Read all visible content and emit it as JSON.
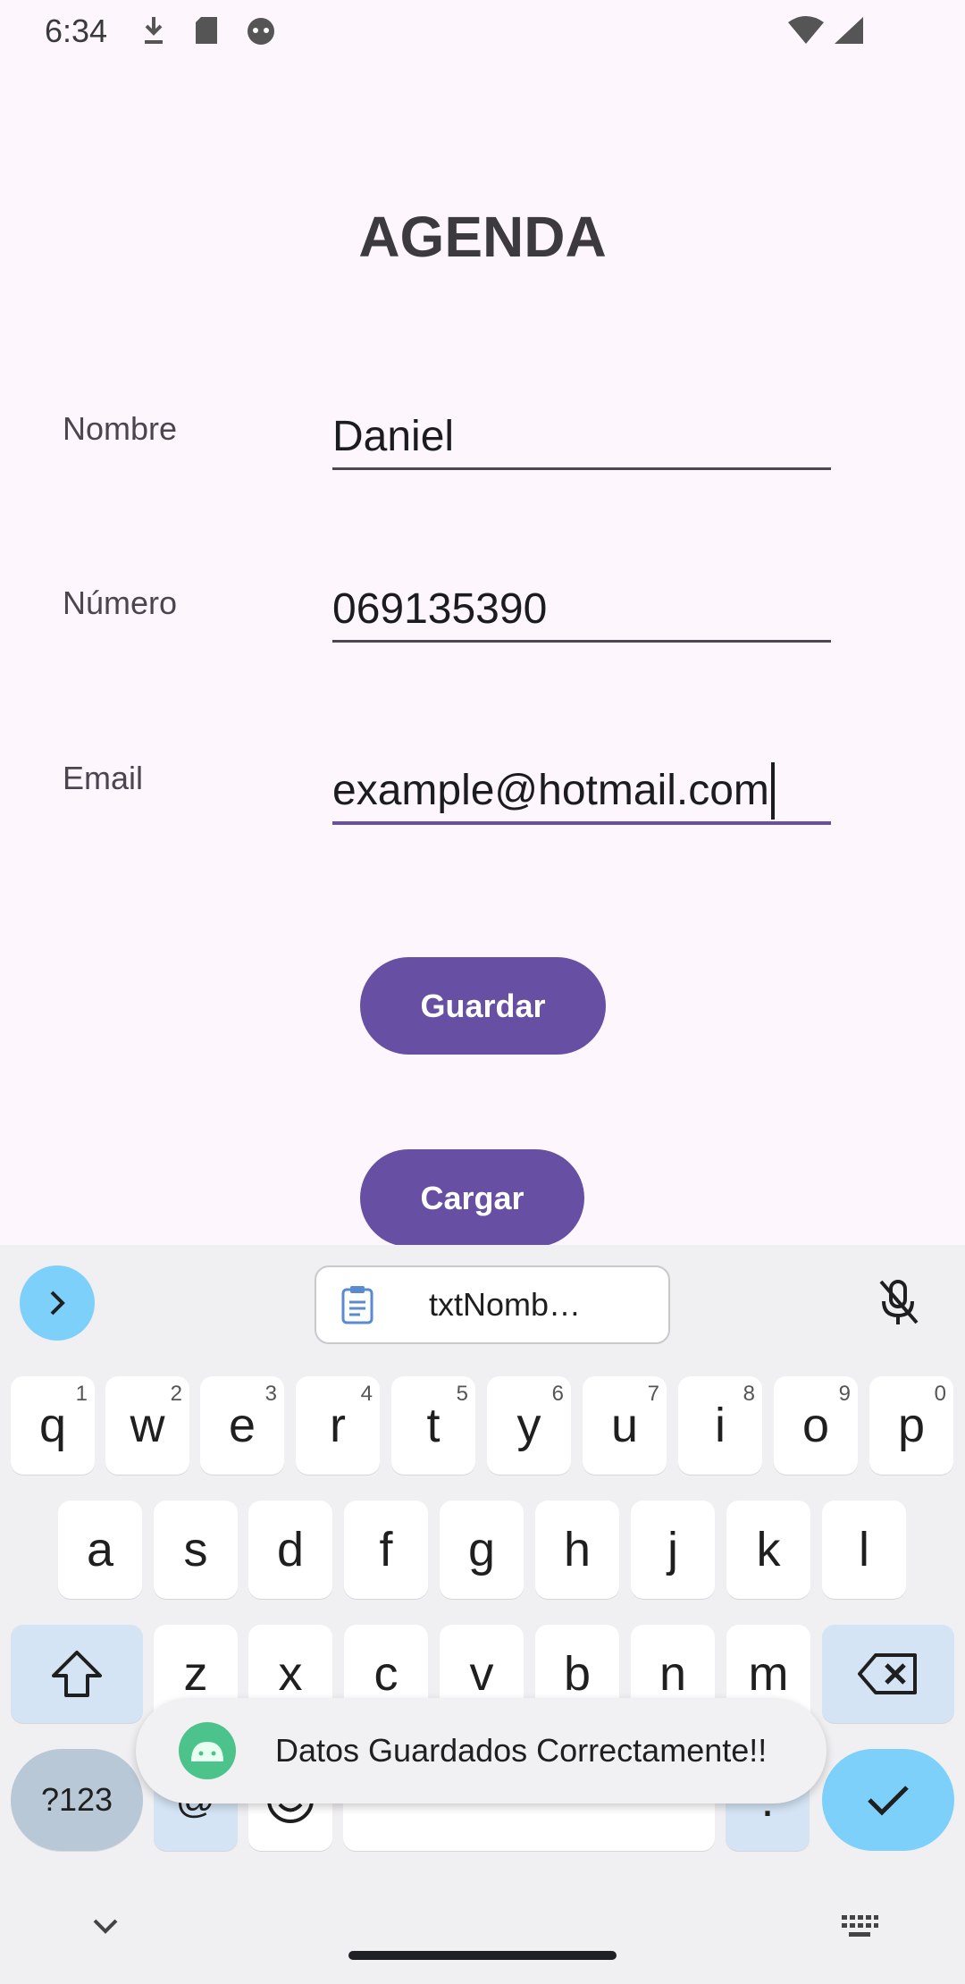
{
  "status_bar": {
    "time": "6:34",
    "icons_left": [
      "download-icon",
      "sd-card-icon",
      "android-face-icon"
    ],
    "icons_right": [
      "wifi-icon",
      "signal-icon"
    ]
  },
  "app": {
    "title": "AGENDA",
    "fields": [
      {
        "label": "Nombre",
        "value": "Daniel"
      },
      {
        "label": "Número",
        "value": "069135390"
      },
      {
        "label": "Email",
        "value": "example@hotmail.com"
      }
    ],
    "buttons": {
      "save": "Guardar",
      "load": "Cargar"
    }
  },
  "keyboard": {
    "suggestion_chip": "txtNomb…",
    "row1": [
      {
        "k": "q",
        "h": "1"
      },
      {
        "k": "w",
        "h": "2"
      },
      {
        "k": "e",
        "h": "3"
      },
      {
        "k": "r",
        "h": "4"
      },
      {
        "k": "t",
        "h": "5"
      },
      {
        "k": "y",
        "h": "6"
      },
      {
        "k": "u",
        "h": "7"
      },
      {
        "k": "i",
        "h": "8"
      },
      {
        "k": "o",
        "h": "9"
      },
      {
        "k": "p",
        "h": "0"
      }
    ],
    "row2": [
      "a",
      "s",
      "d",
      "f",
      "g",
      "h",
      "j",
      "k",
      "l"
    ],
    "row3": [
      "z",
      "x",
      "c",
      "v",
      "b",
      "n",
      "m"
    ],
    "symbols_key": "?123",
    "at_key": "@",
    "period_key": "."
  },
  "toast": {
    "message": "Datos Guardados Correctamente!!"
  },
  "colors": {
    "primary": "#674fa3",
    "background": "#fdf7fd",
    "keyboard_bg": "#f0eff2",
    "accent_blue": "#7dd0fa"
  }
}
